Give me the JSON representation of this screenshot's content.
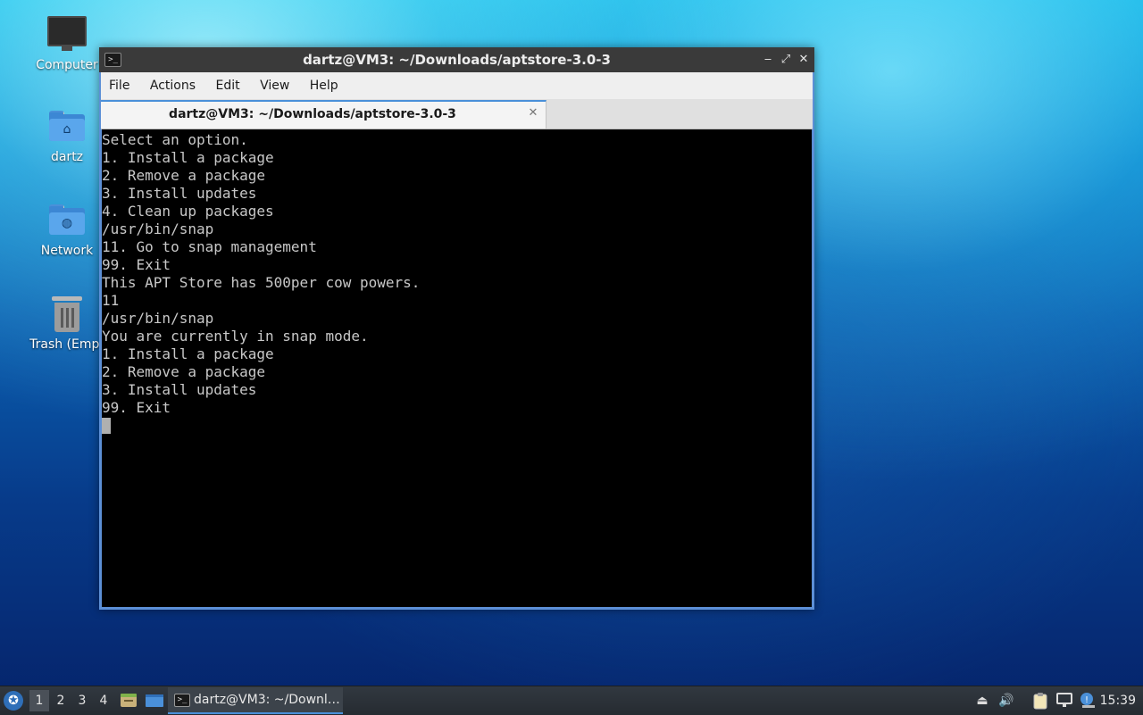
{
  "desktop": {
    "icons": [
      {
        "label": "Computer",
        "icon": "computer-icon"
      },
      {
        "label": "dartz",
        "icon": "home-folder-icon"
      },
      {
        "label": "Network",
        "icon": "network-folder-icon"
      },
      {
        "label": "Trash (Empt",
        "icon": "trash-icon"
      }
    ]
  },
  "window": {
    "title": "dartz@VM3: ~/Downloads/aptstore-3.0-3",
    "app_icon": ">_",
    "controls": {
      "minimize": "‒",
      "maximize": "⤢",
      "close": "✕"
    },
    "menu": [
      "File",
      "Actions",
      "Edit",
      "View",
      "Help"
    ],
    "tab": {
      "label": "dartz@VM3: ~/Downloads/aptstore-3.0-3",
      "close": "✕"
    },
    "terminal_lines": [
      "Select an option.",
      "1. Install a package",
      "2. Remove a package",
      "3. Install updates",
      "4. Clean up packages",
      "/usr/bin/snap",
      "11. Go to snap management",
      "99. Exit",
      "This APT Store has 500per cow powers.",
      "11",
      "/usr/bin/snap",
      "You are currently in snap mode.",
      "1. Install a package",
      "2. Remove a package",
      "3. Install updates",
      "99. Exit"
    ]
  },
  "taskbar": {
    "start_icon": "lubuntu-logo-icon",
    "workspaces": [
      "1",
      "2",
      "3",
      "4"
    ],
    "active_workspace": "1",
    "task_label": "dartz@VM3: ~/Downl…",
    "tray_icons": [
      "eject-icon",
      "volume-icon",
      "clipboard-icon",
      "network-icon",
      "update-notifier-icon"
    ],
    "clock": "15:39"
  },
  "colors": {
    "accent": "#4a90d9",
    "terminal_bg": "#000000",
    "terminal_fg": "#c8c8c8",
    "titlebar": "#3a3a3a"
  }
}
